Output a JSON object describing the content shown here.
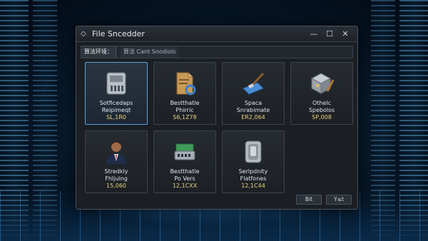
{
  "window": {
    "title": "File Sncedder",
    "icon": "diamond-icon"
  },
  "titlebar_buttons": {
    "minimize": "—",
    "maximize": "☐",
    "close": "✕"
  },
  "tabs": [
    {
      "label": "算法环境：",
      "active": true
    },
    {
      "label": "算法 Cant Snodiols",
      "active": false
    }
  ],
  "cards": [
    {
      "icon": "hard-drive-icon",
      "line1": "Sotficedaps",
      "line2": "Reipimeqt",
      "value": "SL,1R0",
      "selected": true
    },
    {
      "icon": "document-icon",
      "line1": "Bestthatle",
      "line2": "Phirric",
      "value": "S6,1Z78",
      "selected": false
    },
    {
      "icon": "brush-icon",
      "line1": "Spaca",
      "line2": "Snrabimate",
      "value": "ER2,064",
      "selected": false
    },
    {
      "icon": "cube-icon",
      "line1": "Othelc",
      "line2": "Spebolos",
      "value": "SP,008",
      "selected": false
    },
    {
      "icon": "person-icon",
      "line1": "Stredkly",
      "line2": "Fhljuing",
      "value": "15,060",
      "selected": false
    },
    {
      "icon": "circuit-icon",
      "line1": "Bestthatle",
      "line2": "Po Vers",
      "value": "12,1CXX",
      "selected": false
    },
    {
      "icon": "disk-icon",
      "line1": "Serlpdnity",
      "line2": "Flatfones",
      "value": "12,1C44",
      "selected": false
    }
  ],
  "footer": {
    "btn1": "Bit",
    "btn2": "Y≤t"
  },
  "colors": {
    "accent": "#5aa2e0",
    "value_text": "#e9d27a",
    "window_bg": "#1b1f24"
  }
}
